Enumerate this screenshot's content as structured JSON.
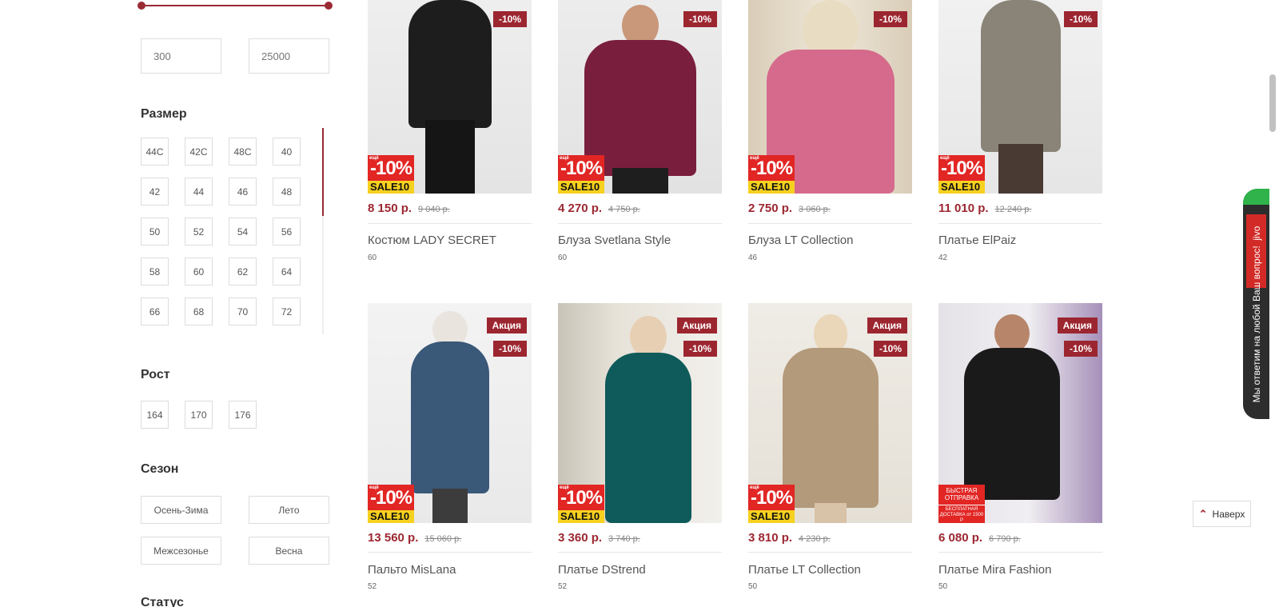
{
  "filters": {
    "price": {
      "min_value": "300",
      "max_value": "25000"
    },
    "size": {
      "title": "Размер",
      "options": [
        "44С",
        "42С",
        "48С",
        "40",
        "42",
        "44",
        "46",
        "48",
        "50",
        "52",
        "54",
        "56",
        "58",
        "60",
        "62",
        "64",
        "66",
        "68",
        "70",
        "72"
      ]
    },
    "height": {
      "title": "Рост",
      "options": [
        "164",
        "170",
        "176"
      ]
    },
    "season": {
      "title": "Сезон",
      "options": [
        "Осень-Зима",
        "Лето",
        "Межсезонье",
        "Весна"
      ]
    },
    "status": {
      "title": "Статус"
    }
  },
  "products": [
    {
      "name": "Костюм LADY SECRET",
      "price": "8 150 р.",
      "old_price": "9 040 р.",
      "size": "60",
      "discount": "-10%",
      "promo": "",
      "sale_label": "-10%",
      "sale_code": "SALE10"
    },
    {
      "name": "Блуза Svetlana Style",
      "price": "4 270 р.",
      "old_price": "4 750 р.",
      "size": "60",
      "discount": "-10%",
      "promo": "",
      "sale_label": "-10%",
      "sale_code": "SALE10"
    },
    {
      "name": "Блуза LT Collection",
      "price": "2 750 р.",
      "old_price": "3 060 р.",
      "size": "46",
      "discount": "-10%",
      "promo": "",
      "sale_label": "-10%",
      "sale_code": "SALE10"
    },
    {
      "name": "Платье ElPaiz",
      "price": "11 010 р.",
      "old_price": "12 240 р.",
      "size": "42",
      "discount": "-10%",
      "promo": "",
      "sale_label": "-10%",
      "sale_code": "SALE10"
    },
    {
      "name": "Пальто MisLana",
      "price": "13 560 р.",
      "old_price": "15 060 р.",
      "size": "52",
      "discount": "-10%",
      "promo": "Акция",
      "sale_label": "-10%",
      "sale_code": "SALE10"
    },
    {
      "name": "Платье DStrend",
      "price": "3 360 р.",
      "old_price": "3 740 р.",
      "size": "52",
      "discount": "-10%",
      "promo": "Акция",
      "sale_label": "-10%",
      "sale_code": "SALE10"
    },
    {
      "name": "Платье LT Collection",
      "price": "3 810 р.",
      "old_price": "4 230 р.",
      "size": "50",
      "discount": "-10%",
      "promo": "Акция",
      "sale_label": "-10%",
      "sale_code": "SALE10"
    },
    {
      "name": "Платье Mira Fashion",
      "price": "6 080 р.",
      "old_price": "6 790 р.",
      "size": "50",
      "discount": "-10%",
      "promo": "Акция",
      "fast_shipping": "БЫСТРАЯ ОТПРАВКА",
      "free_delivery": "БЕСПЛАТНАЯ ДОСТАВКА от 1500 Р"
    }
  ],
  "chat_widget": {
    "label": "Мы ответим на любой Ваш вопрос!",
    "brand": "jivo"
  },
  "back_to_top": {
    "label": "Наверх"
  },
  "colors": {
    "accent": "#9c2630",
    "sale_red": "#e12624",
    "sale_yellow": "#f6d11f"
  },
  "icons": {
    "back_to_top": "chevron-up-icon"
  }
}
